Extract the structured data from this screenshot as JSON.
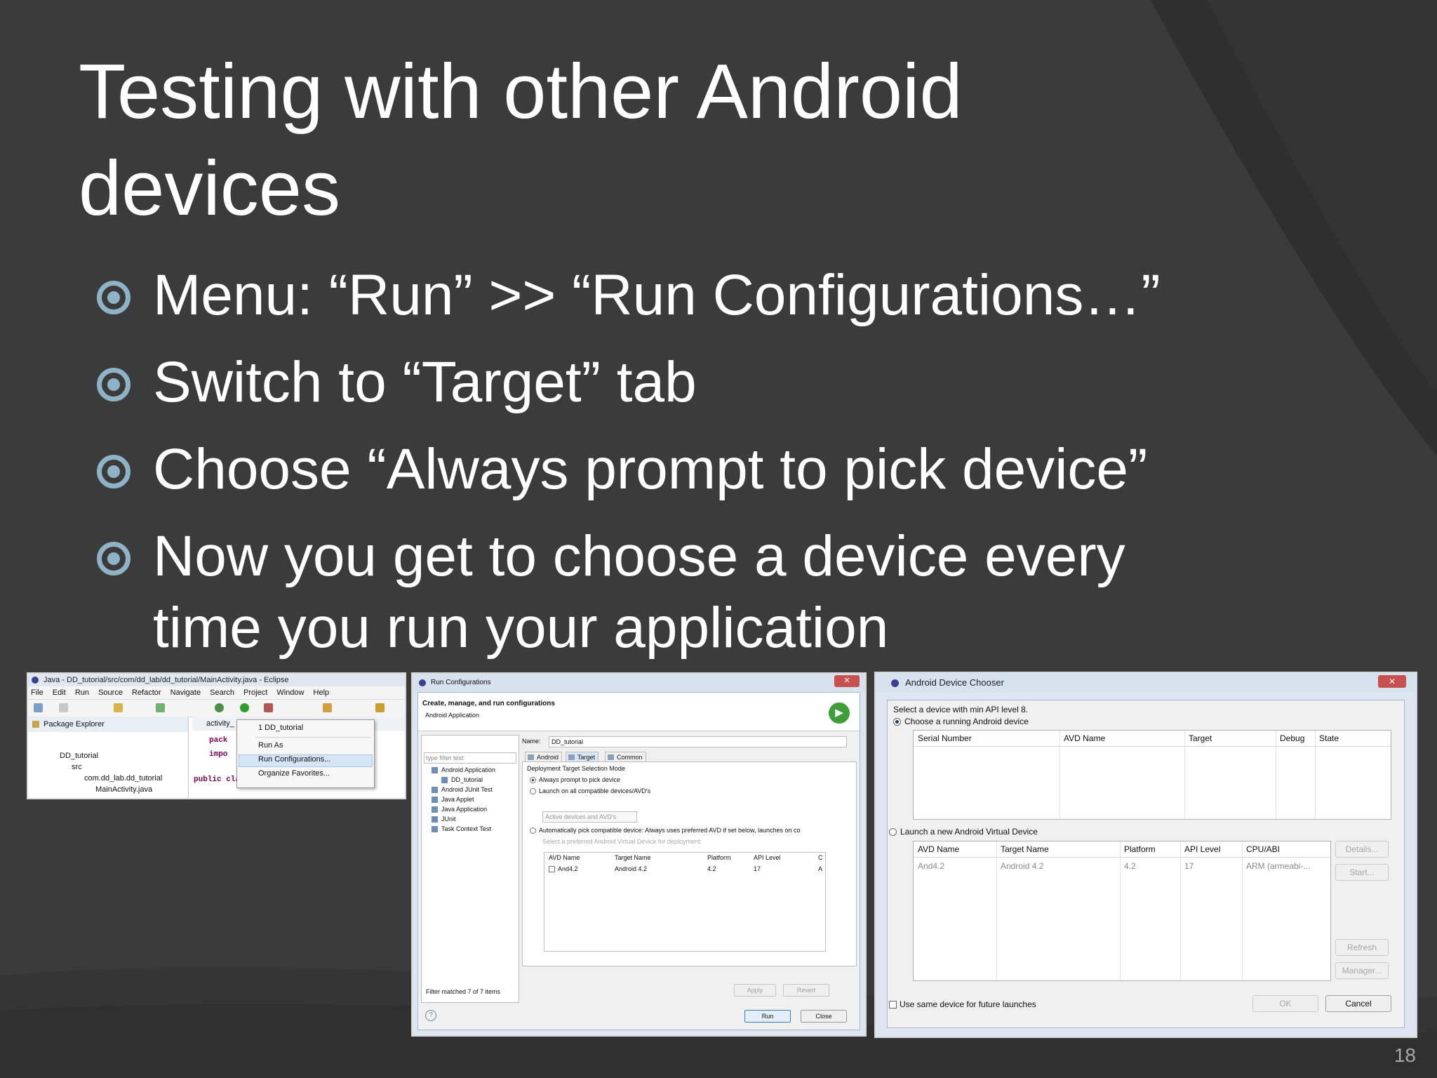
{
  "slide": {
    "title": "Testing with other Android devices",
    "page_number": "18",
    "bullets": [
      "Menu: “Run” >> “Run Configurations…”",
      "Switch to “Target” tab",
      "Choose “Always prompt to pick device”",
      "Now you get to choose a device every time you run your application"
    ]
  },
  "eclipse": {
    "title": "Java - DD_tutorial/src/com/dd_lab/dd_tutorial/MainActivity.java - Eclipse",
    "menu": [
      "File",
      "Edit",
      "Run",
      "Source",
      "Refactor",
      "Navigate",
      "Search",
      "Project",
      "Window",
      "Help"
    ],
    "package_explorer": "Package Explorer",
    "tree": [
      "DD_tutorial",
      "src",
      "com.dd_lab.dd_tutorial",
      "MainActivity.java"
    ],
    "editor_tab": "activity_",
    "code": [
      "pack",
      "impo",
      "public class MainActivity extends Act"
    ],
    "context_menu": [
      "1 DD_tutorial",
      "Run As",
      "Run Configurations...",
      "Organize Favorites..."
    ]
  },
  "run_config": {
    "title": "Run Configurations",
    "header": "Create, manage, and run configurations",
    "subheader": "Android Application",
    "filter_placeholder": "type filter text",
    "tree": [
      "Android Application",
      "DD_tutorial",
      "Android JUnit Test",
      "Java Applet",
      "Java Application",
      "JUnit",
      "Task Context Test"
    ],
    "filter_status": "Filter matched 7 of 7 items",
    "name_label": "Name:",
    "name_value": "DD_tutorial",
    "tabs": [
      "Android",
      "Target",
      "Common"
    ],
    "mode_heading": "Deployment Target Selection Mode",
    "option_prompt": "Always prompt to pick device",
    "option_all": "Launch on all compatible devices/AVD's",
    "combo_value": "Active devices and AVD's",
    "option_auto": "Automatically pick compatible device: Always uses preferred AVD if set below, launches on co",
    "auto_hint": "Select a preferred Android Virtual Device for deployment:",
    "avd_columns": [
      "AVD Name",
      "Target Name",
      "Platform",
      "API Level",
      "C"
    ],
    "avd_row": [
      "And4.2",
      "Android 4.2",
      "4.2",
      "17",
      "A"
    ],
    "buttons": {
      "apply": "Apply",
      "revert": "Revert",
      "run": "Run",
      "close": "Close"
    }
  },
  "chooser": {
    "title": "Android Device Chooser",
    "min_api": "Select a device with min API level 8.",
    "choose_running": "Choose a running Android device",
    "running_columns": [
      "Serial Number",
      "AVD Name",
      "Target",
      "Debug",
      "State"
    ],
    "launch_avd": "Launch a new Android Virtual Device",
    "avd_columns": [
      "AVD Name",
      "Target Name",
      "Platform",
      "API Level",
      "CPU/ABI"
    ],
    "avd_row": [
      "And4.2",
      "Android 4.2",
      "4.2",
      "17",
      "ARM (armeabi-..."
    ],
    "side_buttons": [
      "Details...",
      "Start...",
      "Refresh",
      "Manager..."
    ],
    "use_same": "Use same device for future launches",
    "ok": "OK",
    "cancel": "Cancel"
  }
}
